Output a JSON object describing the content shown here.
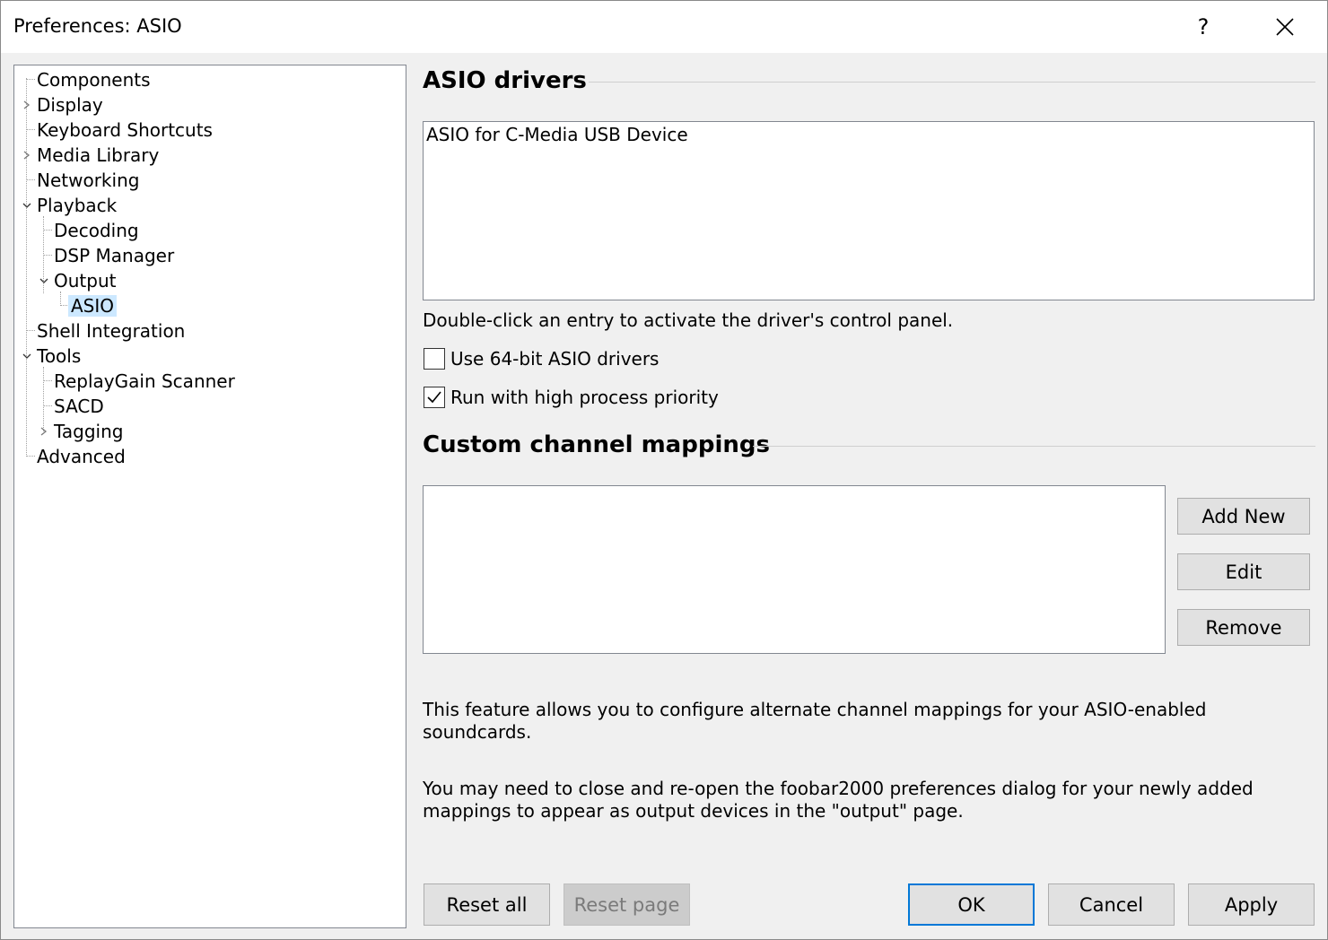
{
  "window": {
    "title": "Preferences: ASIO",
    "help_label": "?"
  },
  "tree": {
    "items": [
      {
        "label": "Components"
      },
      {
        "label": "Display"
      },
      {
        "label": "Keyboard Shortcuts"
      },
      {
        "label": "Media Library"
      },
      {
        "label": "Networking"
      },
      {
        "label": "Playback"
      },
      {
        "label": "Decoding"
      },
      {
        "label": "DSP Manager"
      },
      {
        "label": "Output"
      },
      {
        "label": "ASIO"
      },
      {
        "label": "Shell Integration"
      },
      {
        "label": "Tools"
      },
      {
        "label": "ReplayGain Scanner"
      },
      {
        "label": "SACD"
      },
      {
        "label": "Tagging"
      },
      {
        "label": "Advanced"
      }
    ],
    "selected": "ASIO"
  },
  "asio": {
    "heading": "ASIO drivers",
    "drivers": [
      "ASIO for C-Media USB Device"
    ],
    "hint": "Double-click an entry to activate the driver's control panel.",
    "use64": {
      "label": "Use 64-bit ASIO drivers",
      "checked": false
    },
    "high_priority": {
      "label": "Run with high process priority",
      "checked": true
    }
  },
  "mappings": {
    "heading": "Custom channel mappings",
    "add_label": "Add New",
    "edit_label": "Edit",
    "remove_label": "Remove",
    "info1_line1": "This feature allows you to configure alternate channel mappings for your ASIO-enabled",
    "info1_line2": "soundcards.",
    "info2_line1": "You may need to close and re-open the foobar2000 preferences dialog for your newly added",
    "info2_line2": "mappings to appear as output devices in the \"output\" page."
  },
  "footer": {
    "reset_all": "Reset all",
    "reset_page": "Reset page",
    "ok": "OK",
    "cancel": "Cancel",
    "apply": "Apply"
  },
  "colors": {
    "accent": "#0078d7",
    "selection": "#cce8ff"
  },
  "icons": {
    "close": "close-icon",
    "expand": "chevron-right-icon",
    "collapse": "chevron-down-icon",
    "check": "check-icon"
  }
}
